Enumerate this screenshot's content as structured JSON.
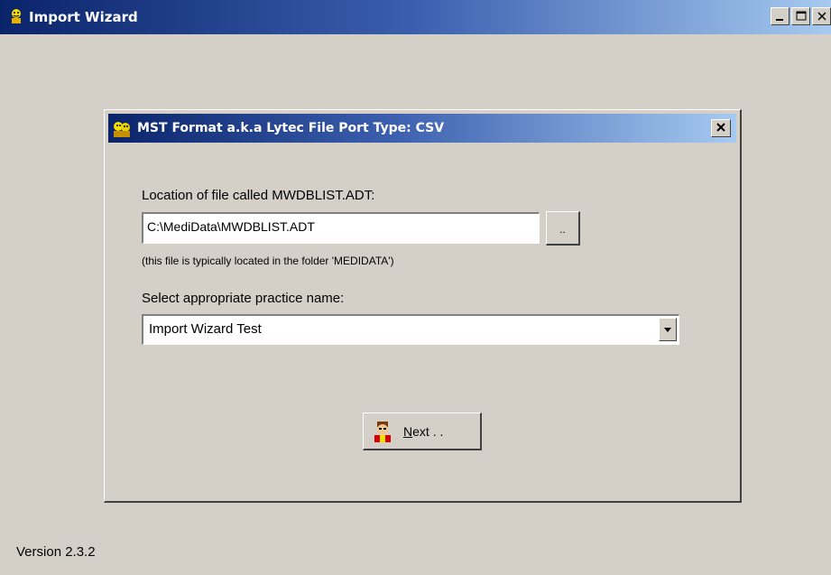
{
  "window": {
    "title": "Import Wizard",
    "icon": "wizard-app-icon"
  },
  "dialog": {
    "title": "MST Format a.k.a Lytec File Port Type: CSV",
    "file_location_label": "Location of file called MWDBLIST.ADT:",
    "file_path_value": "C:\\MediData\\MWDBLIST.ADT",
    "browse_label": "..",
    "hint_text": "(this file is typically located in the folder 'MEDIDATA')",
    "practice_label": "Select appropriate practice name:",
    "practice_selected": "Import Wizard Test",
    "next_label": "Next . ."
  },
  "footer": {
    "version": "Version 2.3.2"
  },
  "colors": {
    "titlebar_start": "#0a246a",
    "titlebar_end": "#a6caf0",
    "face": "#d4d0c8"
  }
}
